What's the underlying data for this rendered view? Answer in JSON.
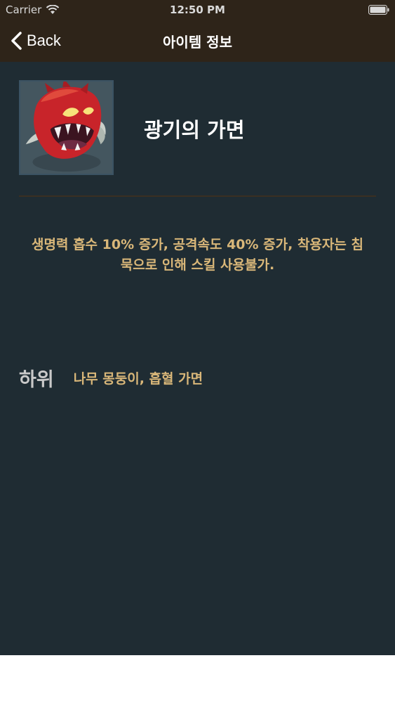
{
  "status_bar": {
    "carrier": "Carrier",
    "time": "12:50 PM"
  },
  "nav": {
    "back_label": "Back",
    "title": "아이템 정보"
  },
  "item": {
    "name": "광기의 가면",
    "image_icon": "red-demon-mask-icon",
    "description": "생명력 흡수 10% 증가, 공격속도 40% 증가, 착용자는 침묵으로 인해 스킬 사용불가.",
    "components_label": "하위",
    "components": "나무 몽둥이, 흡혈 가면"
  },
  "colors": {
    "nav_background": "#2e2419",
    "content_background": "#1f2c33",
    "accent_text": "#d9b779",
    "label_text": "#c9c9c9"
  }
}
